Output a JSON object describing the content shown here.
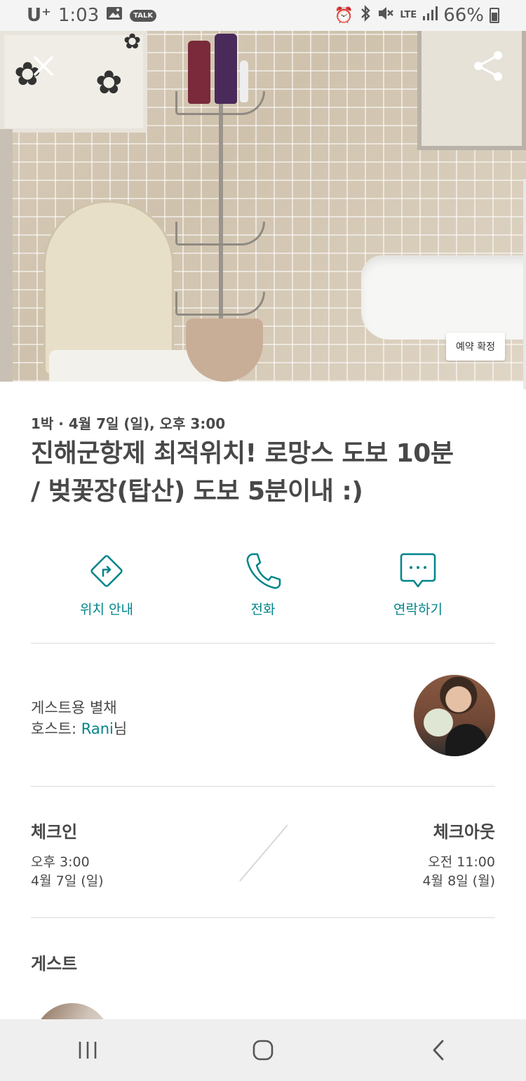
{
  "status_bar": {
    "carrier": "U⁺",
    "time": "1:03",
    "talk_badge": "TALK",
    "network": "LTE",
    "battery": "66%"
  },
  "hero": {
    "booking_badge": "예약 확정"
  },
  "trip": {
    "meta": "1박 · 4월 7일 (일), 오후 3:00",
    "title_line1": "진해군항제 최적위치! 로망스 도보 10분",
    "title_line2": "/ 벚꽃장(탑산) 도보 5분이내 :)"
  },
  "actions": {
    "directions": "위치 안내",
    "call": "전화",
    "message": "연락하기"
  },
  "host": {
    "listing_type": "게스트용 별채",
    "host_prefix": "호스트: ",
    "host_name": "Rani",
    "host_suffix": "님"
  },
  "checkin": {
    "label": "체크인",
    "time": "오후 3:00",
    "date": "4월 7일 (일)"
  },
  "checkout": {
    "label": "체크아웃",
    "time": "오전 11:00",
    "date": "4월 8일 (월)"
  },
  "guests": {
    "heading": "게스트"
  },
  "colors": {
    "accent": "#00848a",
    "text": "#484848",
    "divider": "#ebebeb"
  }
}
